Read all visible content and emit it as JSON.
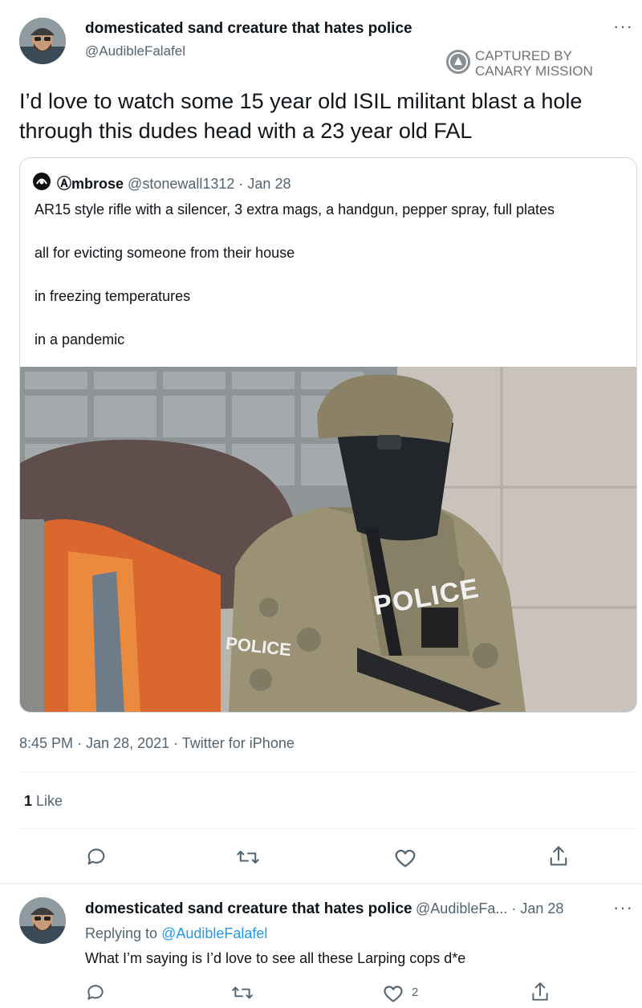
{
  "main_tweet": {
    "display_name": "domesticated sand creature that hates police",
    "handle": "@AudibleFalafel",
    "more": "···",
    "text": "I’d love to watch some 15 year old ISIL militant blast a hole through this dudes head with a 23 year old FAL",
    "timestamp": "8:45 PM · Jan 28, 2021 · Twitter for iPhone",
    "likes_count": "1",
    "likes_label": "Like"
  },
  "watermark": {
    "line1": "CAPTURED BY",
    "line2": "CANARY MISSION",
    "icon": "canary-logo"
  },
  "quoted_tweet": {
    "display_name": "Ⓐmbrose",
    "handle": "@stonewall1312",
    "date": "· Jan 28",
    "lines": [
      "AR15 style rifle with a silencer, 3 extra mags, a handgun, pepper spray, full plates",
      "all for evicting someone from their house",
      "in freezing temperatures",
      "in a pandemic"
    ],
    "image_text": {
      "vest_label": "POLICE",
      "chest_label": "POLICE"
    }
  },
  "reply": {
    "display_name": "domesticated sand creature that hates police",
    "handle_date": "@AudibleFa... · Jan 28",
    "more": "···",
    "replying_prefix": "Replying to",
    "replying_handle": "@AudibleFalafel",
    "text": "What I’m saying is I’d love to see all these Larping cops d*e",
    "like_count": "2"
  },
  "icons": {
    "reply": "reply-icon",
    "retweet": "retweet-icon",
    "like": "heart-icon",
    "share": "share-icon"
  },
  "colors": {
    "text": "#0f1419",
    "secondary": "#536471",
    "link": "#1d9bf0",
    "border": "#cfd9de"
  }
}
